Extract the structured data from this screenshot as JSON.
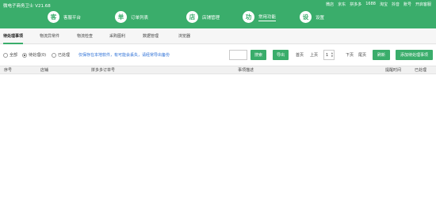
{
  "app": {
    "title": "微电子商务卫士 V21.68"
  },
  "top_links": [
    "微店",
    "京东",
    "拼多多",
    "1688",
    "淘宝",
    "抖音",
    "账号",
    "开启客服"
  ],
  "nav": [
    {
      "icon": "客",
      "label": "客服平台",
      "active": false
    },
    {
      "icon": "单",
      "label": "订单列表",
      "active": false
    },
    {
      "icon": "店",
      "label": "店铺管理",
      "active": false
    },
    {
      "icon": "功",
      "label": "常用功能",
      "active": true
    },
    {
      "icon": "设",
      "label": "设置",
      "active": false
    }
  ],
  "subtabs": [
    "待处理事项",
    "物流异常件",
    "物流检查",
    "采购图利",
    "数据管理",
    "浏览器"
  ],
  "filter": {
    "radios": [
      {
        "label": "全部",
        "checked": false
      },
      {
        "label": "待处理(0)",
        "checked": true
      },
      {
        "label": "已处理",
        "checked": false
      }
    ],
    "hint": "仅保存在本地软件，有可能会丢失，请经常导出备份",
    "search_value": "",
    "search_button": "搜索",
    "export_button": "导出",
    "first_page": "首页",
    "prev_page": "上页",
    "page_number": "1",
    "next_page": "下页",
    "last_page": "尾页",
    "refresh_button": "刷新",
    "add_button": "添加待处理事项"
  },
  "table": {
    "columns": [
      "序号",
      "店铺",
      "拼多多订单号",
      "事项描述",
      "提醒时间",
      "已处理"
    ]
  },
  "colors": {
    "brand_green": "#3aad6b",
    "hint_blue": "#2b6fd6"
  }
}
